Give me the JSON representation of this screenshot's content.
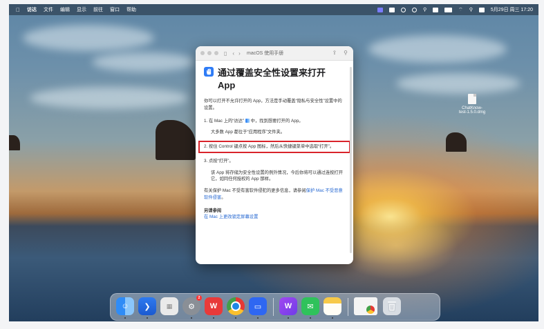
{
  "menubar": {
    "apple": "",
    "items": [
      "访达",
      "文件",
      "编辑",
      "显示",
      "前往",
      "窗口",
      "帮助"
    ],
    "datetime": "5月29日 周三 17:20"
  },
  "window": {
    "title": "macOS 使用手册",
    "heading": "通过覆盖安全性设置来打开 App",
    "intro": "你可以打开不允许打开的 App，方法是手动覆盖“隐私与安全性”设置中的设置。",
    "step1_a": "1. 在 Mac 上的“访达”",
    "step1_b": "中，找到想要打开的 App。",
    "step1_note": "大多数 App 都位于“应用程序”文件夹。",
    "step2": "2. 按住 Control 键点按 App 图标，然后从快捷键菜单中选取“打开”。",
    "step3": "3. 点按“打开”。",
    "step3_note": "该 App 将存储为安全性设置的例外情况，今后你将可以通过连按打开它，如同任何授权的 App 那样。",
    "protect_text": "有关保护 Mac 不受有害软件侵犯的更多信息，请参阅",
    "protect_link": "保护 Mac 不受恶意软件侵害",
    "protect_end": "。",
    "see_also_title": "另请参阅",
    "see_also_link": "在 Mac 上更改锁定屏幕设置"
  },
  "desktop_file": {
    "name_line1": "ChatKnow-",
    "name_line2": "test-1.5.0.dmg"
  },
  "dock": {
    "settings_badge": "2"
  },
  "colors": {
    "accent": "#2366d1",
    "highlight_border": "#d9232a"
  }
}
